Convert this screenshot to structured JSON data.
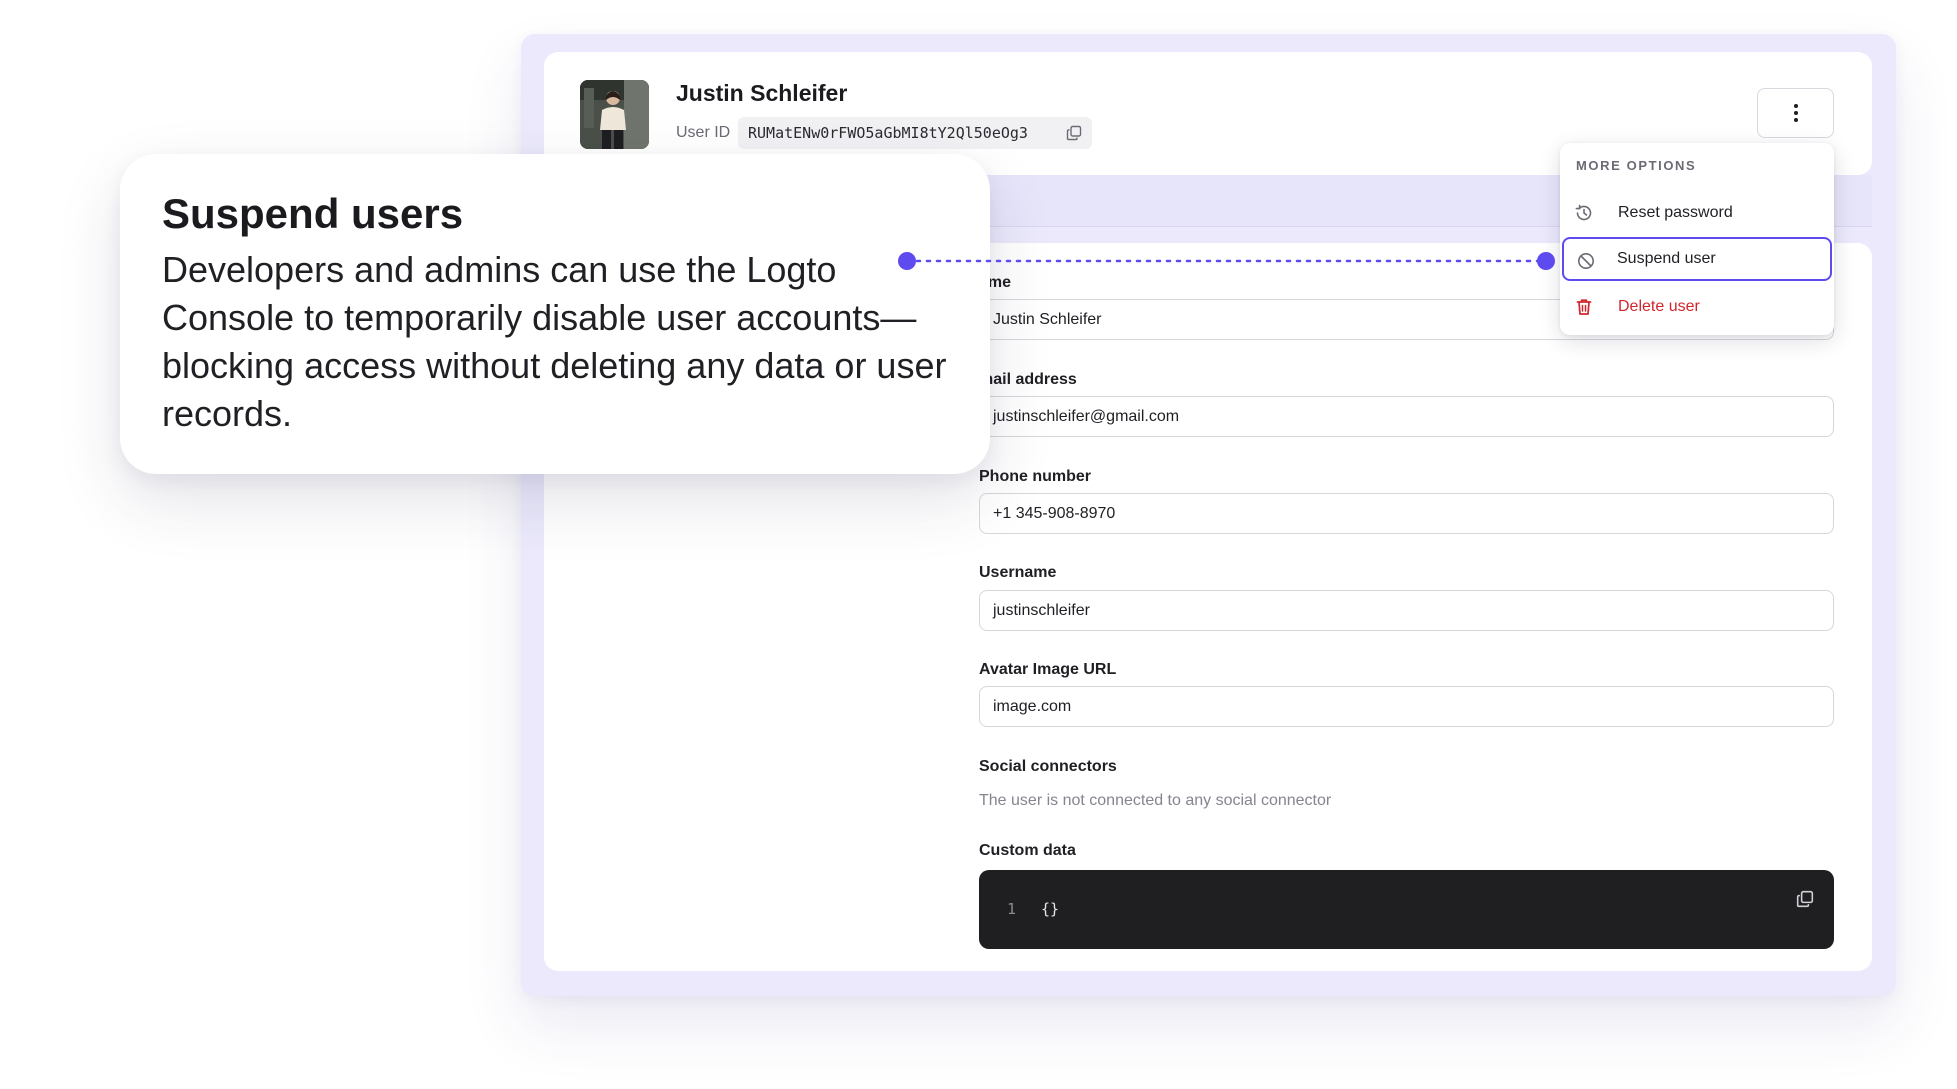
{
  "header": {
    "user_name": "Justin Schleifer",
    "user_id_label": "User ID",
    "user_id_value": "RUMatENw0rFWO5aGbMI8tY2Ql50eOg3"
  },
  "more_options": {
    "title": "MORE OPTIONS",
    "items": [
      {
        "label": "Reset password",
        "icon": "history-icon"
      },
      {
        "label": "Suspend user",
        "icon": "block-icon",
        "highlighted": true
      },
      {
        "label": "Delete user",
        "icon": "trash-icon",
        "color": "#d2262e"
      }
    ]
  },
  "form": {
    "name": {
      "label": "ame",
      "value": "Justin Schleifer"
    },
    "email": {
      "label": "mail address",
      "value": "justinschleifer@gmail.com"
    },
    "phone": {
      "label": "Phone number",
      "value": "+1 345-908-8970"
    },
    "username": {
      "label": "Username",
      "value": "justinschleifer"
    },
    "avatar_url": {
      "label": "Avatar Image URL",
      "value": "image.com"
    },
    "social": {
      "label": "Social connectors",
      "empty_text": "The user is not connected to any social connector"
    },
    "custom_data": {
      "label": "Custom data",
      "line_number": "1",
      "code": "{}"
    }
  },
  "callout": {
    "title": "Suspend users",
    "body": "Developers and admins can use the Logto Console to temporarily disable user accounts—blocking access without deleting any data or user records."
  },
  "colors": {
    "accent": "#5d4bf0",
    "danger": "#d2262e",
    "frame_bg": "#ebe9fb"
  }
}
